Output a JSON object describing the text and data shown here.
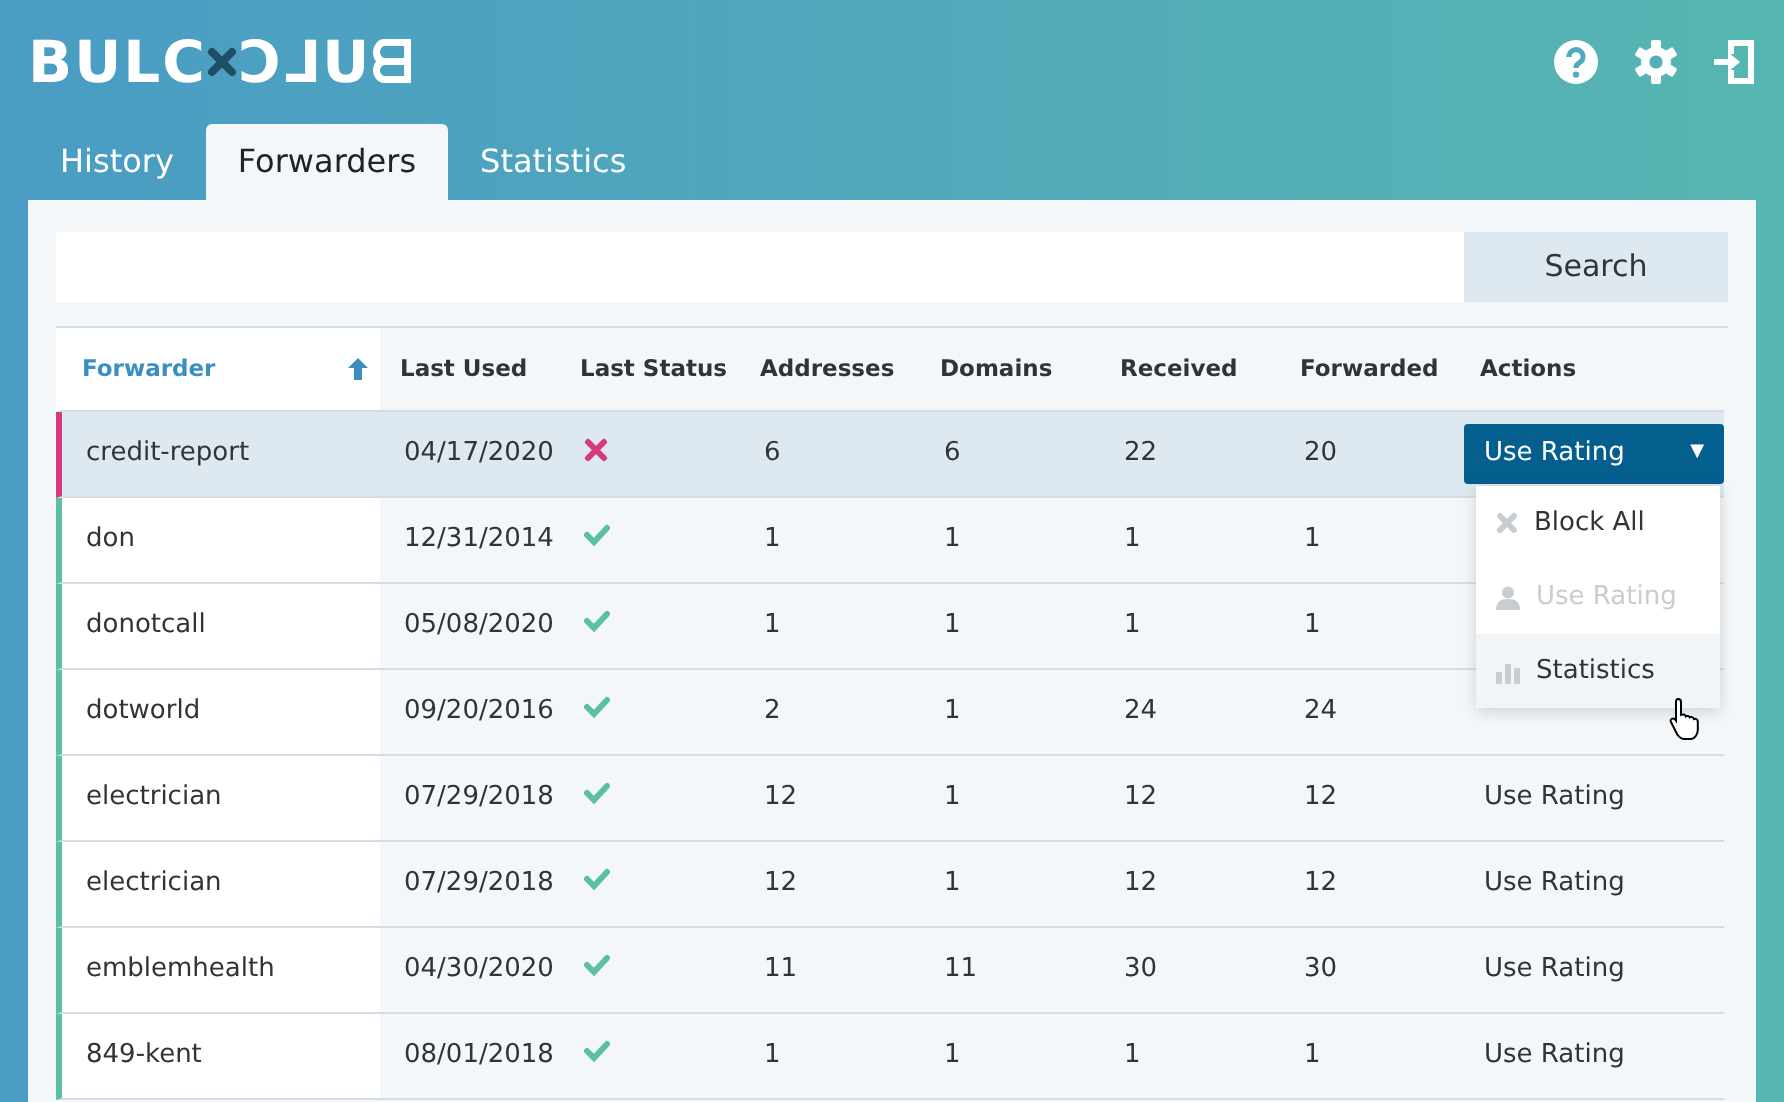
{
  "logo": {
    "left": "BULC",
    "right": "Ɔ⅃Uᗺ"
  },
  "tabs": [
    {
      "label": "History",
      "selected": false
    },
    {
      "label": "Forwarders",
      "selected": true
    },
    {
      "label": "Statistics",
      "selected": false
    }
  ],
  "search": {
    "button": "Search"
  },
  "table": {
    "columns": [
      {
        "label": "Forwarder",
        "sorted": true
      },
      {
        "label": "Last Used",
        "sorted": false
      },
      {
        "label": "Last Status",
        "sorted": false
      },
      {
        "label": "Addresses",
        "sorted": false
      },
      {
        "label": "Domains",
        "sorted": false
      },
      {
        "label": "Received",
        "sorted": false
      },
      {
        "label": "Forwarded",
        "sorted": false
      },
      {
        "label": "Actions",
        "sorted": false
      }
    ],
    "rows": [
      {
        "forwarder": "credit-report",
        "last_used": "04/17/2020",
        "failed": true,
        "addresses": "6",
        "domains": "6",
        "received": "22",
        "forwarded": "20",
        "selected": true,
        "action": {
          "kind": "dropdown",
          "label": "Use Rating",
          "caret": "▼"
        }
      },
      {
        "forwarder": "don",
        "last_used": "12/31/2014",
        "failed": false,
        "addresses": "1",
        "domains": "1",
        "received": "1",
        "forwarded": "1",
        "selected": false
      },
      {
        "forwarder": "donotcall",
        "last_used": "05/08/2020",
        "failed": false,
        "addresses": "1",
        "domains": "1",
        "received": "1",
        "forwarded": "1",
        "selected": false
      },
      {
        "forwarder": "dotworld",
        "last_used": "09/20/2016",
        "failed": false,
        "addresses": "2",
        "domains": "1",
        "received": "24",
        "forwarded": "24",
        "selected": false
      },
      {
        "forwarder": "electrician",
        "last_used": "07/29/2018",
        "failed": false,
        "addresses": "12",
        "domains": "1",
        "received": "12",
        "forwarded": "12",
        "selected": false,
        "action": {
          "kind": "link",
          "label": "Use Rating"
        }
      },
      {
        "forwarder": "electrician",
        "last_used": "07/29/2018",
        "failed": false,
        "addresses": "12",
        "domains": "1",
        "received": "12",
        "forwarded": "12",
        "selected": false,
        "action": {
          "kind": "link",
          "label": "Use Rating"
        }
      },
      {
        "forwarder": "emblemhealth",
        "last_used": "04/30/2020",
        "failed": false,
        "addresses": "11",
        "domains": "11",
        "received": "30",
        "forwarded": "30",
        "selected": false,
        "action": {
          "kind": "link",
          "label": "Use Rating"
        }
      },
      {
        "forwarder": "849-kent",
        "last_used": "08/01/2018",
        "failed": false,
        "addresses": "1",
        "domains": "1",
        "received": "1",
        "forwarded": "1",
        "selected": false,
        "action": {
          "kind": "link",
          "label": "Use Rating"
        }
      }
    ]
  },
  "menu": {
    "items": [
      {
        "label": "Block All",
        "disabled": false,
        "hovered": false
      },
      {
        "label": "Use Rating",
        "disabled": true,
        "hovered": false
      },
      {
        "label": "Statistics",
        "disabled": false,
        "hovered": true
      }
    ]
  }
}
